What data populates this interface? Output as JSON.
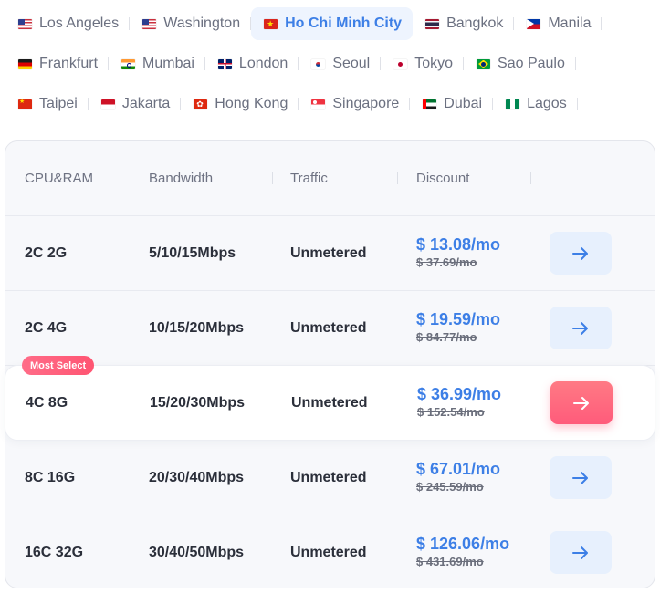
{
  "cities": {
    "rows": [
      [
        {
          "label": "Los Angeles",
          "flag": "flag-us-icon",
          "fc": "f-us",
          "active": false
        },
        {
          "label": "Washington",
          "flag": "flag-us-icon",
          "fc": "f-us",
          "active": false
        },
        {
          "label": "Ho Chi Minh City",
          "flag": "flag-vn-icon",
          "fc": "f-vn",
          "active": true
        },
        {
          "label": "Bangkok",
          "flag": "flag-th-icon",
          "fc": "f-th",
          "active": false
        },
        {
          "label": "Manila",
          "flag": "flag-ph-icon",
          "fc": "f-ph",
          "active": false
        }
      ],
      [
        {
          "label": "Frankfurt",
          "flag": "flag-de-icon",
          "fc": "f-de",
          "active": false
        },
        {
          "label": "Mumbai",
          "flag": "flag-in-icon",
          "fc": "f-in",
          "active": false
        },
        {
          "label": "London",
          "flag": "flag-gb-icon",
          "fc": "f-gb",
          "active": false
        },
        {
          "label": "Seoul",
          "flag": "flag-kr-icon",
          "fc": "f-kr",
          "active": false
        },
        {
          "label": "Tokyo",
          "flag": "flag-jp-icon",
          "fc": "f-jp",
          "active": false
        },
        {
          "label": "Sao Paulo",
          "flag": "flag-br-icon",
          "fc": "f-br",
          "active": false
        }
      ],
      [
        {
          "label": "Taipei",
          "flag": "flag-cn-icon",
          "fc": "f-cn",
          "active": false
        },
        {
          "label": "Jakarta",
          "flag": "flag-id-icon",
          "fc": "f-id",
          "active": false
        },
        {
          "label": "Hong Kong",
          "flag": "flag-hk-icon",
          "fc": "f-hk",
          "active": false
        },
        {
          "label": "Singapore",
          "flag": "flag-sg-icon",
          "fc": "f-sg",
          "active": false
        },
        {
          "label": "Dubai",
          "flag": "flag-ae-icon",
          "fc": "f-ae",
          "active": false
        },
        {
          "label": "Lagos",
          "flag": "flag-ng-icon",
          "fc": "f-ng",
          "active": false
        }
      ]
    ]
  },
  "table": {
    "headers": {
      "cpu_ram": "CPU&RAM",
      "bandwidth": "Bandwidth",
      "traffic": "Traffic",
      "discount": "Discount"
    },
    "plans": [
      {
        "spec": "2C 2G",
        "bandwidth": "5/10/15Mbps",
        "traffic": "Unmetered",
        "price": "$ 13.08/mo",
        "old_price": "$ 37.69/mo"
      },
      {
        "spec": "2C 4G",
        "bandwidth": "10/15/20Mbps",
        "traffic": "Unmetered",
        "price": "$ 19.59/mo",
        "old_price": "$ 84.77/mo"
      },
      {
        "spec": "4C 8G",
        "bandwidth": "15/20/30Mbps",
        "traffic": "Unmetered",
        "price": "$ 36.99/mo",
        "old_price": "$ 152.54/mo",
        "badge": "Most Select"
      },
      {
        "spec": "8C 16G",
        "bandwidth": "20/30/40Mbps",
        "traffic": "Unmetered",
        "price": "$ 67.01/mo",
        "old_price": "$ 245.59/mo"
      },
      {
        "spec": "16C 32G",
        "bandwidth": "30/40/50Mbps",
        "traffic": "Unmetered",
        "price": "$ 126.06/mo",
        "old_price": "$ 431.69/mo"
      }
    ],
    "featured_index": 2,
    "colors": {
      "accent": "#3d7fe6",
      "hot": "#ff5b7b",
      "button_bg": "#e7f0fd"
    }
  }
}
